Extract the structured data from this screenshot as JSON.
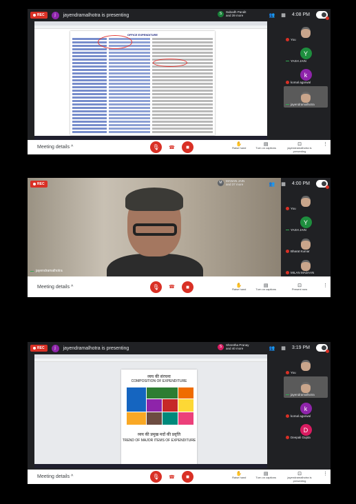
{
  "panels": [
    {
      "presenter_initial": "j",
      "presenter_text": "jayendramalhotra is presenting",
      "people_initial": "S",
      "people_color": "#188038",
      "people_text": [
        "Subodh Pandit",
        "and 39 more"
      ],
      "people_count": "39",
      "time": "4:08 PM",
      "tiles": [
        {
          "name": "You",
          "type": "cam",
          "mute": true
        },
        {
          "name": "YASH JAIN",
          "initial": "Y",
          "color": "#1e8e3e",
          "mute": false
        },
        {
          "name": "komal agarwal",
          "initial": "k",
          "color": "#8e24aa",
          "mute": true
        },
        {
          "name": "jayendramalhotra",
          "type": "cam",
          "mute": false
        }
      ],
      "right_buttons": [
        {
          "icon": "✋",
          "label": "Raise hand"
        },
        {
          "icon": "▤",
          "label": "Turn on captions"
        },
        {
          "icon": "⊡",
          "label": "jayendramalhotra is presenting"
        }
      ]
    },
    {
      "people_initial": "M",
      "people_color": "#5f6368",
      "people_text": [
        "MANAN JAIN",
        "and 37 more"
      ],
      "people_count": "37",
      "time": "4:00 PM",
      "tiles": [
        {
          "name": "You",
          "type": "cam",
          "mute": true
        },
        {
          "name": "YASH JAIN",
          "initial": "Y",
          "color": "#1e8e3e",
          "mute": false
        },
        {
          "name": "Bharat Kumar",
          "type": "cam",
          "mute": true
        },
        {
          "name": "MILAN MADAAN",
          "type": "cam",
          "mute": true
        }
      ],
      "video_name": "jayendramalhotra",
      "right_buttons": [
        {
          "icon": "✋",
          "label": "Raise hand"
        },
        {
          "icon": "▤",
          "label": "Turn on captions"
        },
        {
          "icon": "⊡",
          "label": "Present now"
        }
      ]
    },
    {
      "presenter_initial": "j",
      "presenter_text": "jayendramalhotra is presenting",
      "people_initial": "S",
      "people_color": "#d81b60",
      "people_text": [
        "Shrestha Pranay",
        "and 40 more"
      ],
      "people_count": "40",
      "time": "3:19 PM",
      "tiles": [
        {
          "name": "You",
          "type": "cam",
          "mute": true
        },
        {
          "name": "jayendramalhotra",
          "type": "cam",
          "mute": false
        },
        {
          "name": "komal agarwal",
          "initial": "k",
          "color": "#8e24aa",
          "mute": true
        },
        {
          "name": "Deepali Gupta",
          "initial": "D",
          "color": "#d81b60",
          "mute": true
        }
      ],
      "chart_title_hi": "व्यय की संरचना",
      "chart_title_en": "COMPOSITION OF EXPENDITURE",
      "chart_sub_hi": "व्यय की प्रमुख मदों की प्रवृत्ति",
      "chart_sub_en": "TREND OF MAJOR ITEMS OF EXPENDITURE",
      "right_buttons": [
        {
          "icon": "✋",
          "label": "Raise hand"
        },
        {
          "icon": "▤",
          "label": "Turn on captions"
        },
        {
          "icon": "⊡",
          "label": "jayendramalhotra is presenting"
        }
      ]
    }
  ],
  "common": {
    "rec": "REC",
    "meeting_details": "Meeting details",
    "doc_header": "OFFICE EXPENDITURE",
    "caret": "^"
  }
}
